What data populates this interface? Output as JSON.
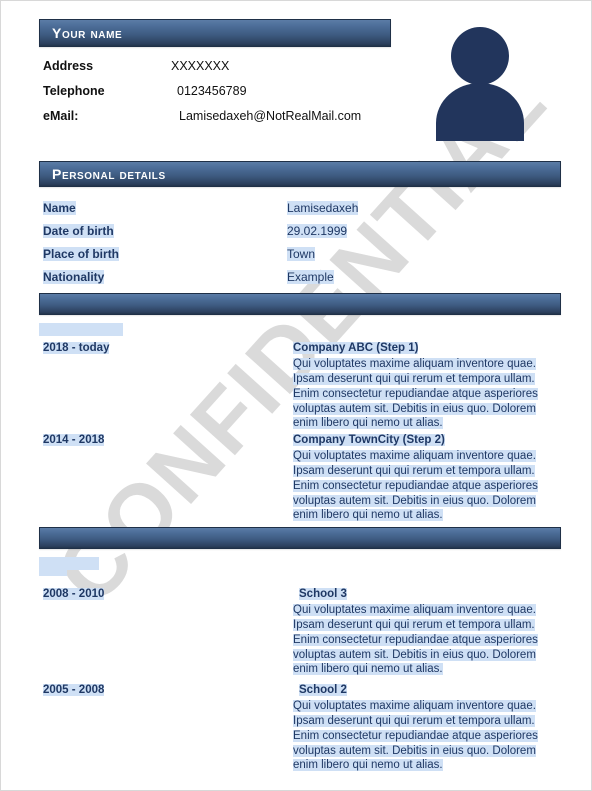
{
  "watermark": {
    "text": "CONFIDENTIAL"
  },
  "colors": {
    "bar_top": "#5b7ca6",
    "bar_bottom": "#22334a",
    "text_blue": "#1f3864",
    "selection_highlight": "#cfe0f5",
    "avatar": "#22355c"
  },
  "header": {
    "name_bar_title": "Your name",
    "contact": [
      {
        "label": "Address",
        "value": "XXXXXXX"
      },
      {
        "label": "Telephone",
        "value": "0123456789"
      },
      {
        "label": "eMail:",
        "value": "Lamisedaxeh@NotRealMail.com"
      }
    ]
  },
  "personal_details": {
    "bar_title": "Personal details",
    "rows": [
      {
        "label": "Name",
        "value": "Lamisedaxeh"
      },
      {
        "label": "Date of birth",
        "value": "29.02.1999"
      },
      {
        "label": "Place of birth",
        "value": "Town"
      },
      {
        "label": "Nationality",
        "value": "Example"
      }
    ]
  },
  "work_experience": {
    "bar_title": "",
    "blank_selection_title": "",
    "entries": [
      {
        "date": "2018 - today",
        "title": "Company ABC (Step 1)",
        "description": "Qui voluptates maxime aliquam inventore quae. Ipsam deserunt qui qui rerum et tempora ullam. Enim consectetur repudiandae atque asperiores voluptas autem sit. Debitis in eius quo. Dolorem enim libero qui nemo ut alias."
      },
      {
        "date": "2014 - 2018",
        "title": "Company TownCity (Step 2)",
        "description": "Qui voluptates maxime aliquam inventore quae. Ipsam deserunt qui qui rerum et tempora ullam. Enim consectetur repudiandae atque asperiores voluptas autem sit. Debitis in eius quo. Dolorem enim libero qui nemo ut alias."
      }
    ]
  },
  "education": {
    "bar_title": "",
    "blank_selection_title": "",
    "entries": [
      {
        "date": "2008 - 2010",
        "title": "School 3",
        "description": "Qui voluptates maxime aliquam inventore quae. Ipsam deserunt qui qui rerum et tempora ullam. Enim consectetur repudiandae atque asperiores voluptas autem sit. Debitis in eius quo. Dolorem enim libero qui nemo ut alias."
      },
      {
        "date": "2005 - 2008",
        "title": "School 2",
        "description": "Qui voluptates maxime aliquam inventore quae. Ipsam deserunt qui qui rerum et tempora ullam. Enim consectetur repudiandae atque asperiores voluptas autem sit. Debitis in eius quo. Dolorem enim libero qui nemo ut alias."
      }
    ]
  }
}
